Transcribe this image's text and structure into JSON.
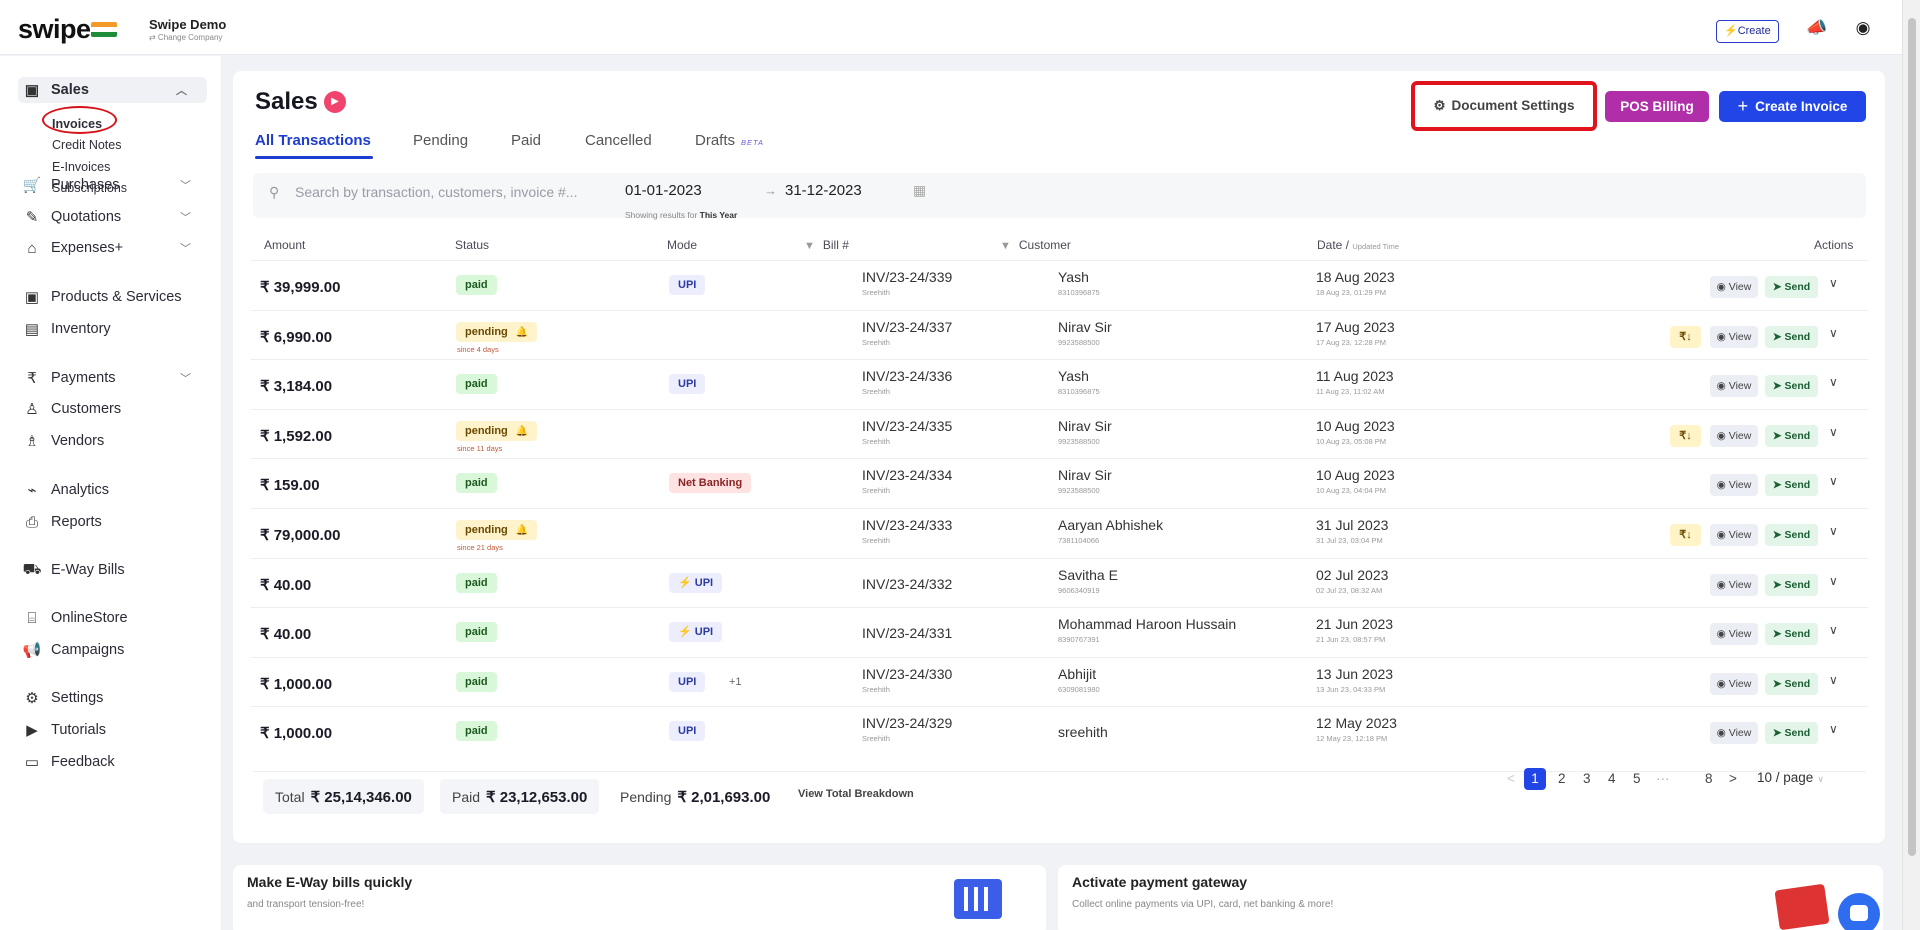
{
  "app": {
    "logo": "swipe",
    "company_name": "Swipe Demo",
    "change_company": "⇄ Change Company",
    "create_button": "⚡Create"
  },
  "sidebar": {
    "sales": "Sales",
    "sub_items": [
      "Invoices",
      "Credit Notes",
      "E-Invoices",
      "Subscriptions"
    ],
    "items": [
      {
        "label": "Purchases",
        "icon": "cart-icon",
        "glyph": "🛒"
      },
      {
        "label": "Quotations",
        "icon": "pen-icon",
        "glyph": "✎"
      },
      {
        "label": "Expenses+",
        "icon": "tag-icon",
        "glyph": "⌂"
      },
      {
        "label": "Products & Services",
        "icon": "box-icon",
        "glyph": "▣"
      },
      {
        "label": "Inventory",
        "icon": "warehouse-icon",
        "glyph": "▤"
      },
      {
        "label": "Payments",
        "icon": "rupee-icon",
        "glyph": "₹"
      },
      {
        "label": "Customers",
        "icon": "user-icon",
        "glyph": "♙"
      },
      {
        "label": "Vendors",
        "icon": "users-icon",
        "glyph": "♗"
      },
      {
        "label": "Analytics",
        "icon": "chart-icon",
        "glyph": "⌁"
      },
      {
        "label": "Reports",
        "icon": "report-icon",
        "glyph": "⎙"
      },
      {
        "label": "E-Way Bills",
        "icon": "truck-icon",
        "glyph": "⛟"
      },
      {
        "label": "OnlineStore",
        "icon": "store-icon",
        "glyph": "⌸"
      },
      {
        "label": "Campaigns",
        "icon": "megaphone-icon",
        "glyph": "📢"
      },
      {
        "label": "Settings",
        "icon": "gear-icon",
        "glyph": "⚙"
      },
      {
        "label": "Tutorials",
        "icon": "youtube-icon",
        "glyph": "▶"
      },
      {
        "label": "Feedback",
        "icon": "chat-icon",
        "glyph": "▭"
      }
    ]
  },
  "main": {
    "title": "Sales",
    "tabs": [
      "All Transactions",
      "Pending",
      "Paid",
      "Cancelled",
      "Drafts"
    ],
    "beta": "BETA",
    "doc_settings": "Document Settings",
    "pos_billing": "POS Billing",
    "create_invoice": "Create Invoice",
    "search_placeholder": "Search by transaction, customers, invoice #...",
    "date_from": "01-01-2023",
    "date_to": "31-12-2023",
    "showing_prefix": "Showing results for",
    "showing_period": "This Year",
    "columns": {
      "amount": "Amount",
      "status": "Status",
      "mode": "Mode",
      "bill": "Bill #",
      "customer": "Customer",
      "date": "Date /",
      "date_small": "Updated Time",
      "actions": "Actions"
    },
    "view_label": "View",
    "send_label": "Send",
    "rows": [
      {
        "amount": "₹ 39,999.00",
        "status": "paid",
        "since": "",
        "mode": "UPI",
        "mode_type": "upi",
        "extra": "",
        "bill": "INV/23-24/339",
        "bill_by": "Sreehith",
        "customer": "Yash",
        "phone": "8310396875",
        "date": "18 Aug 2023",
        "time": "18 Aug 23, 01:29 PM",
        "rupee": false
      },
      {
        "amount": "₹ 6,990.00",
        "status": "pending",
        "since": "since 4 days",
        "mode": "",
        "mode_type": "",
        "extra": "",
        "bill": "INV/23-24/337",
        "bill_by": "Sreehith",
        "customer": "Nirav Sir",
        "phone": "9923588500",
        "date": "17 Aug 2023",
        "time": "17 Aug 23, 12:28 PM",
        "rupee": true
      },
      {
        "amount": "₹ 3,184.00",
        "status": "paid",
        "since": "",
        "mode": "UPI",
        "mode_type": "upi",
        "extra": "",
        "bill": "INV/23-24/336",
        "bill_by": "Sreehith",
        "customer": "Yash",
        "phone": "8310396875",
        "date": "11 Aug 2023",
        "time": "11 Aug 23, 11:02 AM",
        "rupee": false
      },
      {
        "amount": "₹ 1,592.00",
        "status": "pending",
        "since": "since 11 days",
        "mode": "",
        "mode_type": "",
        "extra": "",
        "bill": "INV/23-24/335",
        "bill_by": "Sreehith",
        "customer": "Nirav Sir",
        "phone": "9923588500",
        "date": "10 Aug 2023",
        "time": "10 Aug 23, 05:08 PM",
        "rupee": true
      },
      {
        "amount": "₹ 159.00",
        "status": "paid",
        "since": "",
        "mode": "Net Banking",
        "mode_type": "nb",
        "extra": "",
        "bill": "INV/23-24/334",
        "bill_by": "Sreehith",
        "customer": "Nirav Sir",
        "phone": "9923588500",
        "date": "10 Aug 2023",
        "time": "10 Aug 23, 04:04 PM",
        "rupee": false
      },
      {
        "amount": "₹ 79,000.00",
        "status": "pending",
        "since": "since 21 days",
        "mode": "",
        "mode_type": "",
        "extra": "",
        "bill": "INV/23-24/333",
        "bill_by": "Sreehith",
        "customer": "Aaryan Abhishek",
        "phone": "7381104066",
        "date": "31 Jul 2023",
        "time": "31 Jul 23, 03:04 PM",
        "rupee": true
      },
      {
        "amount": "₹ 40.00",
        "status": "paid",
        "since": "",
        "mode": "⚡ UPI",
        "mode_type": "upi",
        "extra": "",
        "bill": "INV/23-24/332",
        "bill_by": "",
        "customer": "Savitha E",
        "phone": "9606340919",
        "date": "02 Jul 2023",
        "time": "02 Jul 23, 08:32 AM",
        "rupee": false
      },
      {
        "amount": "₹ 40.00",
        "status": "paid",
        "since": "",
        "mode": "⚡ UPI",
        "mode_type": "upi",
        "extra": "",
        "bill": "INV/23-24/331",
        "bill_by": "",
        "customer": "Mohammad Haroon Hussain",
        "phone": "8390767391",
        "date": "21 Jun 2023",
        "time": "21 Jun 23, 08:57 PM",
        "rupee": false
      },
      {
        "amount": "₹ 1,000.00",
        "status": "paid",
        "since": "",
        "mode": "UPI",
        "mode_type": "upi",
        "extra": "+1",
        "bill": "INV/23-24/330",
        "bill_by": "Sreehith",
        "customer": "Abhijit",
        "phone": "6309081980",
        "date": "13 Jun 2023",
        "time": "13 Jun 23, 04:33 PM",
        "rupee": false
      },
      {
        "amount": "₹ 1,000.00",
        "status": "paid",
        "since": "",
        "mode": "UPI",
        "mode_type": "upi",
        "extra": "",
        "bill": "INV/23-24/329",
        "bill_by": "Sreehith",
        "customer": "sreehith",
        "phone": "",
        "date": "12 May 2023",
        "time": "12 May 23, 12:18 PM",
        "rupee": false
      }
    ],
    "totals": {
      "total_label": "Total",
      "total_value": "₹ 25,14,346.00",
      "paid_label": "Paid",
      "paid_value": "₹ 23,12,653.00",
      "pending_label": "Pending",
      "pending_value": "₹ 2,01,693.00",
      "breakdown": "View Total Breakdown"
    },
    "pagination": {
      "prev": "<",
      "pages": [
        "1",
        "2",
        "3",
        "4",
        "5"
      ],
      "ellipsis": "···",
      "last": "8",
      "next": ">",
      "current": "1",
      "per_page": "10 / page"
    }
  },
  "promos": [
    {
      "title": "Make E-Way bills quickly",
      "text": "and transport tension-free!"
    },
    {
      "title": "Activate payment gateway",
      "text": "Collect online payments via UPI, card, net banking & more!"
    }
  ],
  "colors": {
    "accent": "#2145e6",
    "pos": "#b02fa8",
    "highlight": "#e0131c"
  }
}
